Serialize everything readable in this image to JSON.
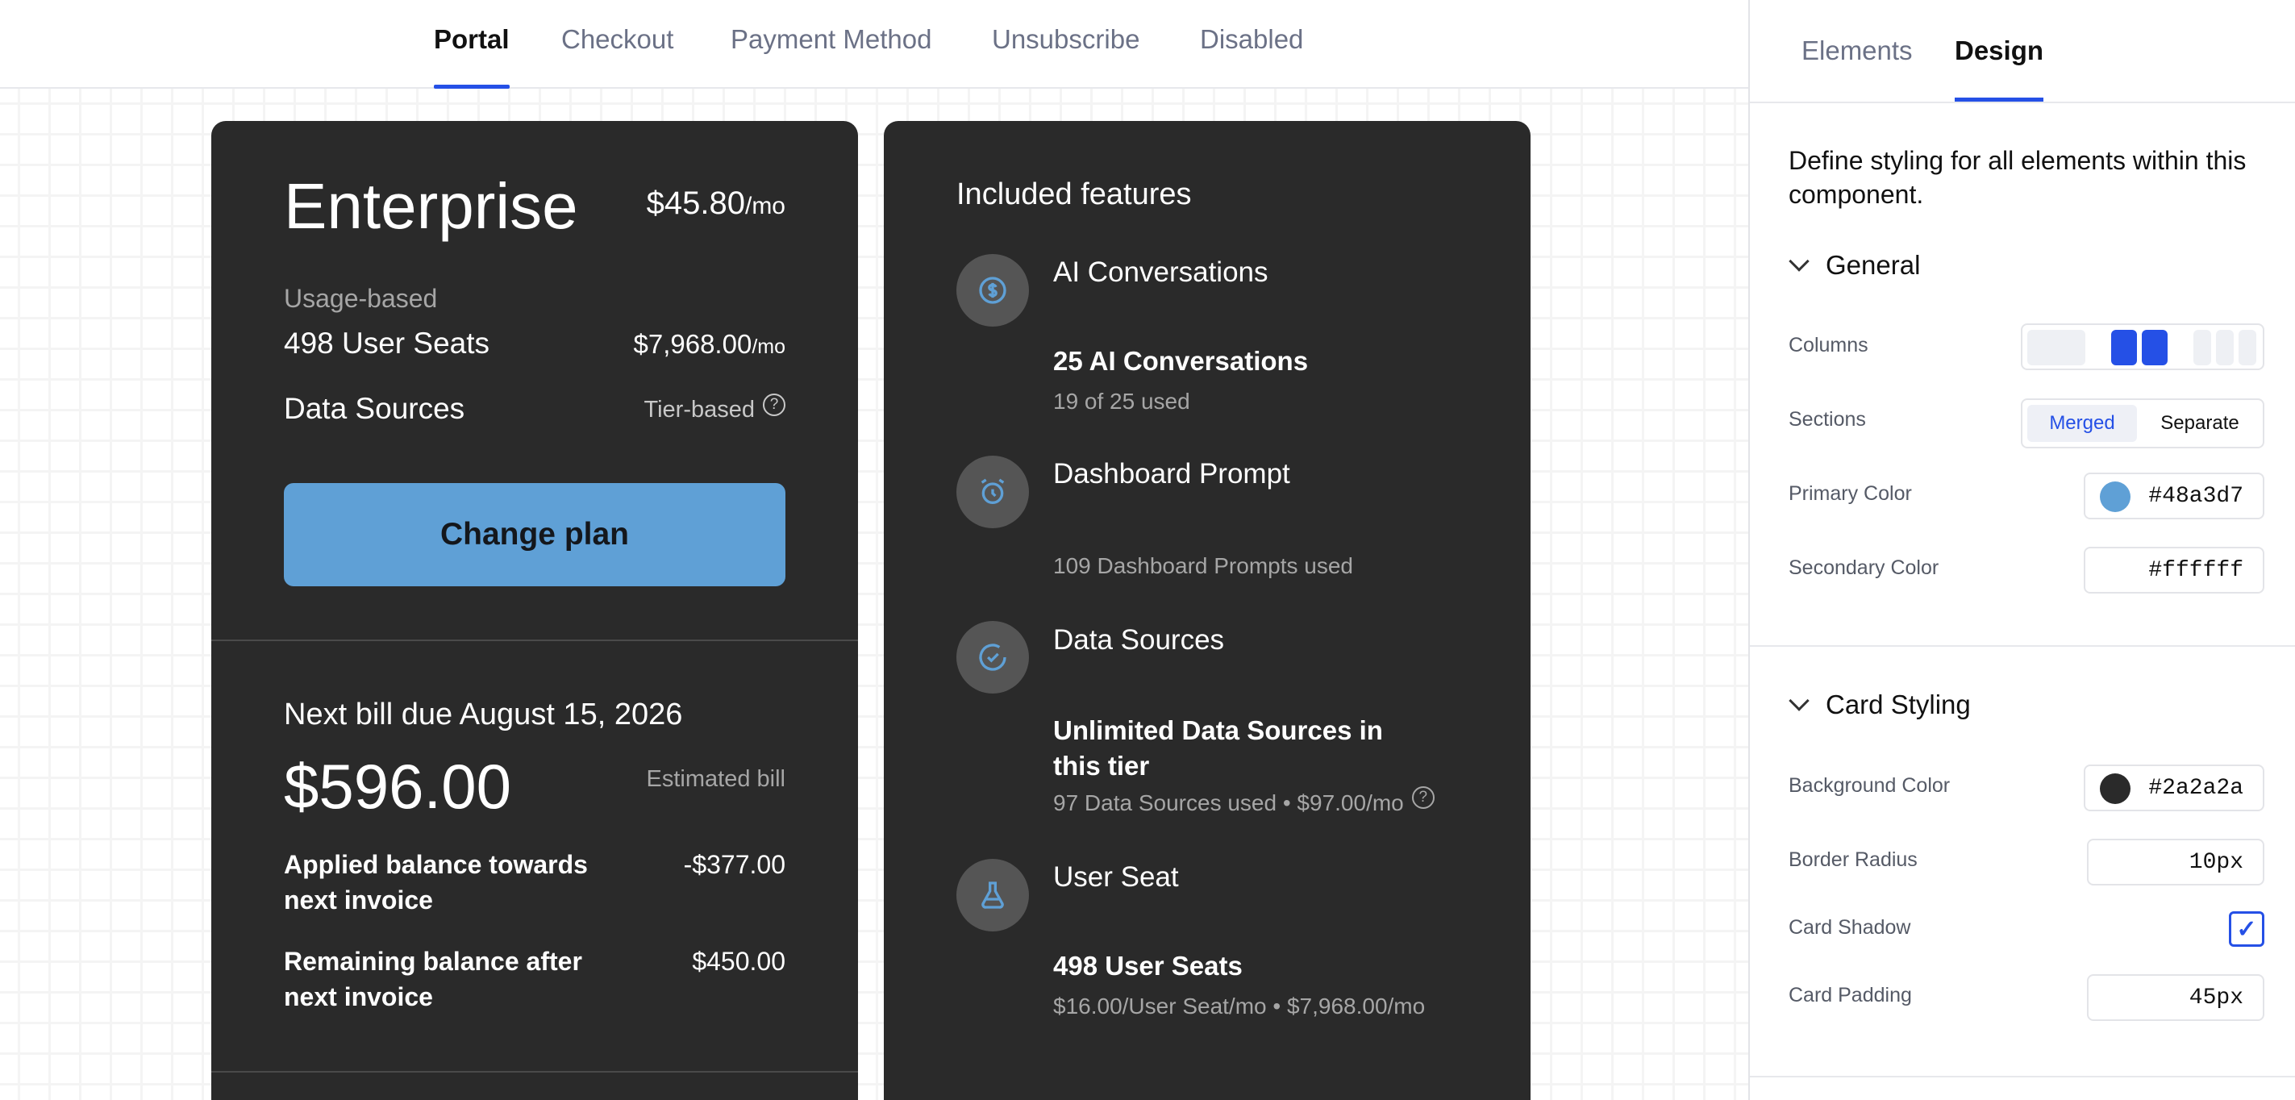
{
  "topnav": {
    "tabs": [
      {
        "label": "Portal"
      },
      {
        "label": "Checkout"
      },
      {
        "label": "Payment Method"
      },
      {
        "label": "Unsubscribe"
      },
      {
        "label": "Disabled"
      }
    ]
  },
  "plan": {
    "name": "Enterprise",
    "price": "$45.80",
    "price_unit": "/mo",
    "usage_label": "Usage-based",
    "seats_name": "498 User Seats",
    "seats_price": "$7,968.00",
    "seats_unit": "/mo",
    "data_sources_name": "Data Sources",
    "data_sources_tier": "Tier-based",
    "change_plan_label": "Change plan"
  },
  "bill": {
    "next_due": "Next bill due August 15, 2026",
    "amount": "$596.00",
    "estimated_label": "Estimated bill",
    "applied_label": "Applied balance towards next invoice",
    "applied_value": "-$377.00",
    "remaining_label": "Remaining balance after next invoice",
    "remaining_value": "$450.00"
  },
  "features": {
    "title": "Included features",
    "items": [
      {
        "name": "AI Conversations",
        "icon": "dollar-circle-icon",
        "sub": "25 AI Conversations",
        "detail": "19 of 25 used"
      },
      {
        "name": "Dashboard Prompt",
        "icon": "alarm-clock-icon",
        "sub": "",
        "detail": "109 Dashboard Prompts used"
      },
      {
        "name": "Data Sources",
        "icon": "check-circle-icon",
        "sub": "Unlimited Data Sources in this tier",
        "detail": "97 Data Sources used • $97.00/mo"
      },
      {
        "name": "User Seat",
        "icon": "flask-icon",
        "sub": "498 User Seats",
        "detail": "$16.00/User Seat/mo • $7,968.00/mo"
      }
    ]
  },
  "panel": {
    "tabs": [
      {
        "label": "Elements"
      },
      {
        "label": "Design"
      }
    ],
    "description": "Define styling for all elements within this component.",
    "general": {
      "title": "General",
      "columns_label": "Columns",
      "sections_label": "Sections",
      "sections_options": [
        "Merged",
        "Separate"
      ],
      "primary_label": "Primary Color",
      "primary_value": "#48a3d7",
      "secondary_label": "Secondary Color",
      "secondary_value": "#ffffff"
    },
    "card_styling": {
      "title": "Card Styling",
      "bg_label": "Background Color",
      "bg_value": "#2a2a2a",
      "radius_label": "Border Radius",
      "radius_value": "10px",
      "shadow_label": "Card Shadow",
      "shadow_checked": true,
      "padding_label": "Card Padding",
      "padding_value": "45px"
    }
  },
  "colors": {
    "accent": "#2550e6",
    "primary": "#48a3d7",
    "card_bg": "#2a2a2a"
  }
}
